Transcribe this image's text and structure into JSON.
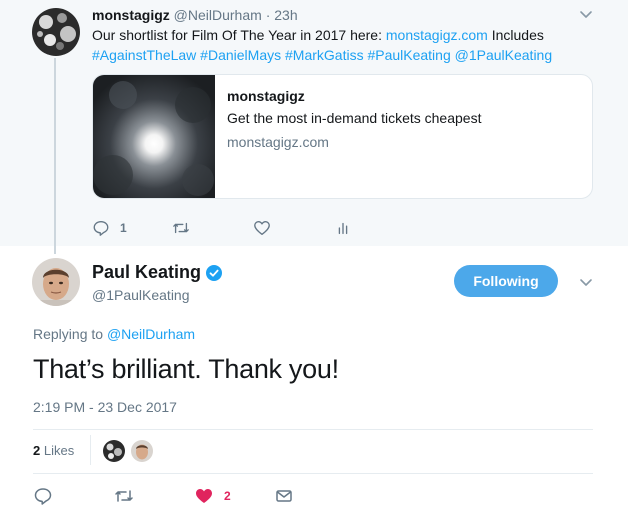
{
  "parent_tweet": {
    "display_name": "monstagigz",
    "handle": "@NeilDurham",
    "separator": "·",
    "time": "23h",
    "text_plain": "Our shortlist for Film Of The Year in 2017 here: ",
    "text_link": "monstagigz.com",
    "text_after": " Includes",
    "hashtags_line": "#AgainstTheLaw #DanielMays #MarkGatiss #PaulKeating @1PaulKeating",
    "card": {
      "title": "monstagigz",
      "description": "Get the most in-demand tickets cheapest",
      "domain": "monstagigz.com"
    },
    "actions": {
      "reply_count": "1"
    }
  },
  "main_tweet": {
    "display_name": "Paul Keating",
    "handle": "@1PaulKeating",
    "follow_label": "Following",
    "replying_prefix": "Replying to ",
    "replying_to": "@NeilDurham",
    "text": "That’s brilliant. Thank you!",
    "timestamp": "2:19 PM - 23 Dec 2017",
    "likes_count": "2",
    "likes_label": " Likes",
    "actions": {
      "like_count": "2"
    }
  },
  "colors": {
    "accent": "#1da1f2",
    "follow_button": "#4ca8ea",
    "like_red": "#e0245e",
    "muted": "#657786",
    "parent_bg": "#f5f8fa"
  },
  "icons": {
    "reply": "reply-icon",
    "retweet": "retweet-icon",
    "like": "heart-icon",
    "analytics": "analytics-icon",
    "dm": "envelope-icon",
    "caret": "chevron-down-icon",
    "verified": "verified-badge-icon"
  }
}
